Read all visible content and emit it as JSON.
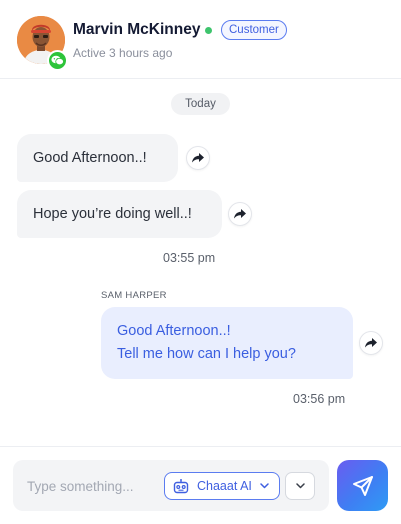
{
  "contact": {
    "name": "Marvin McKinney",
    "status": "online",
    "role": "Customer",
    "last_active": "Active 3 hours ago",
    "channel_icon": "wechat-icon"
  },
  "conversation": {
    "date_divider": "Today",
    "incoming": [
      {
        "text": "Good Afternoon..!"
      },
      {
        "text": "Hope you’re doing well..!"
      }
    ],
    "incoming_time": "03:55 pm",
    "outgoing": {
      "sender": "SAM HARPER",
      "lines": [
        "Good Afternoon..!",
        "Tell me how can I help you?"
      ],
      "time": "03:56 pm"
    }
  },
  "composer": {
    "placeholder": "Type something...",
    "ai_button_label": "Chaaat AI",
    "send_icon": "send-icon"
  },
  "colors": {
    "accent": "#3f5fe0",
    "online": "#3ec46d",
    "channel": "#2dc43a",
    "incoming_bubble": "#f3f4f6",
    "outgoing_bubble": "#e9eefe"
  }
}
